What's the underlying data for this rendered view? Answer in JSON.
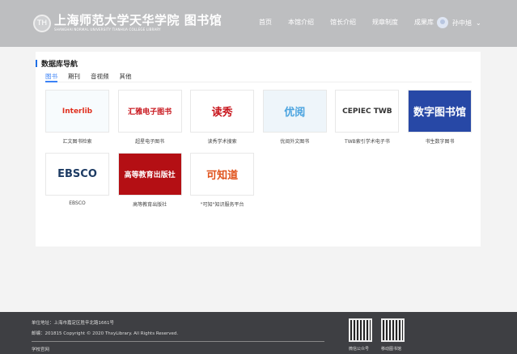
{
  "header": {
    "logo_cn": "上海师范大学天华学院 图书馆",
    "logo_en": "SHANGHAI NORMAL UNIVERSITY TIANHUA COLLEGE LIBRARY",
    "nav": [
      "首页",
      "本馆介绍",
      "馆长介绍",
      "规章制度",
      "成果库"
    ],
    "user": "孙中旭"
  },
  "main": {
    "title": "数据库导航",
    "tabs": [
      "图书",
      "期刊",
      "音视频",
      "其他"
    ],
    "items": [
      {
        "label": "汇文图书检索",
        "logo": "Interlib",
        "color": "#e0301e",
        "bg": "#f7fbfd"
      },
      {
        "label": "超星电子图书",
        "logo": "汇雅电子图书",
        "color": "#c8161d",
        "bg": "#fff"
      },
      {
        "label": "读秀学术搜索",
        "logo": "读秀",
        "color": "#c8161d",
        "bg": "#fff"
      },
      {
        "label": "优阅外文图书",
        "logo": "优阅",
        "color": "#4aa3df",
        "bg": "#eef5fa"
      },
      {
        "label": "TWB索引学术电子书",
        "logo": "CEPIEC TWB",
        "color": "#333",
        "bg": "#fff"
      },
      {
        "label": "书生数字图书",
        "logo": "数字图书馆",
        "color": "#fff",
        "bg": "#2748a6"
      },
      {
        "label": "EBSCO",
        "logo": "EBSCO",
        "color": "#1d3b63",
        "bg": "#fff"
      },
      {
        "label": "高等教育出版社",
        "logo": "高等教育出版社",
        "color": "#fff",
        "bg": "#b40f14"
      },
      {
        "label": "\"可知\"知识服务平台",
        "logo": "可知道",
        "color": "#e0531c",
        "bg": "#fff"
      }
    ]
  },
  "footer": {
    "address": "单位地址：上海市嘉定区胜辛北路1661号",
    "copyright": "邮编：201815 Copyright © 2020 ThxyLibrary. All Rights Reserved.",
    "link": "学校官网",
    "qr": [
      "微信公众号",
      "移动图书馆"
    ]
  }
}
